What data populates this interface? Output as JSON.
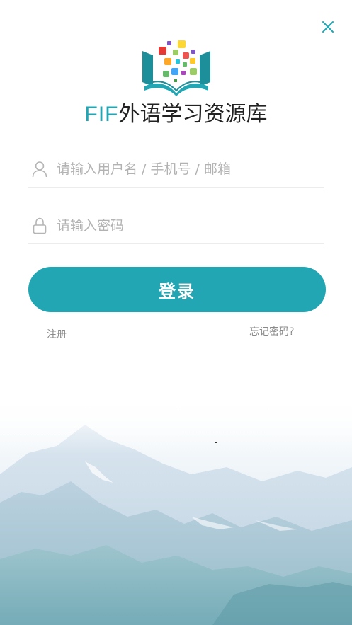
{
  "brand": {
    "title_prefix": "FIF",
    "title_suffix": "外语学习资源库",
    "accent_color": "#22a6b3"
  },
  "header": {
    "close_icon": "close-icon"
  },
  "form": {
    "username": {
      "icon": "user-icon",
      "placeholder": "请输入用户名 / 手机号 / 邮箱",
      "value": ""
    },
    "password": {
      "icon": "lock-icon",
      "placeholder": "请输入密码",
      "value": ""
    },
    "login_label": "登录"
  },
  "links": {
    "register": "注册",
    "forgot_password": "忘记密码?"
  }
}
